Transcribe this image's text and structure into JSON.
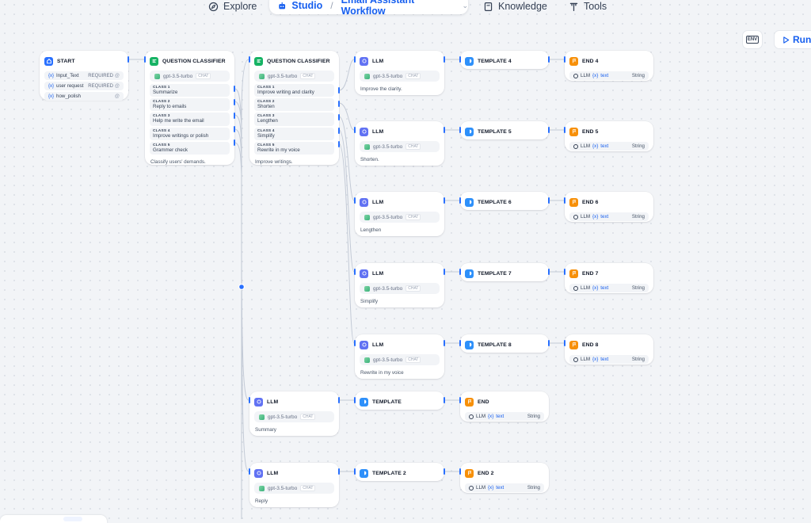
{
  "nav": {
    "explore": "Explore",
    "studio": "Studio",
    "separator": "/",
    "app_name": "Email Assistant Workflow",
    "knowledge": "Knowledge",
    "tools": "Tools"
  },
  "toolbar": {
    "env_label": "ENV",
    "run_label": "Run"
  },
  "start": {
    "title": "START",
    "vars": [
      {
        "name": "Input_Text",
        "flag": "REQUIRED"
      },
      {
        "name": "user request",
        "flag": "REQUIRED"
      },
      {
        "name": "how_polish",
        "flag": ""
      }
    ]
  },
  "qc1": {
    "title": "QUESTION CLASSIFIER",
    "model": "gpt-3.5-turbo",
    "mode": "CHAT",
    "classes": [
      {
        "label": "CLASS 1",
        "value": "Summarize"
      },
      {
        "label": "CLASS 2",
        "value": "Reply to emails"
      },
      {
        "label": "CLASS 3",
        "value": "Help me write the email"
      },
      {
        "label": "CLASS 4",
        "value": "Improve writings or polish"
      },
      {
        "label": "CLASS 5",
        "value": "Grammer check"
      }
    ],
    "desc": "Classify users' demands."
  },
  "qc2": {
    "title": "QUESTION CLASSIFIER",
    "model": "gpt-3.5-turbo",
    "mode": "CHAT",
    "classes": [
      {
        "label": "CLASS 1",
        "value": "Improve writing and clarity"
      },
      {
        "label": "CLASS 2",
        "value": "Shorten"
      },
      {
        "label": "CLASS 3",
        "value": "Lengthen"
      },
      {
        "label": "CLASS 4",
        "value": "Simplify"
      },
      {
        "label": "CLASS 5",
        "value": "Rewrite in my voice"
      }
    ],
    "desc": "Improve writings."
  },
  "llm_nodes": [
    {
      "title": "LLM",
      "model": "gpt-3.5-turbo",
      "mode": "CHAT",
      "desc": "Improve the clarity."
    },
    {
      "title": "LLM",
      "model": "gpt-3.5-turbo",
      "mode": "CHAT",
      "desc": "Shorten."
    },
    {
      "title": "LLM",
      "model": "gpt-3.5-turbo",
      "mode": "CHAT",
      "desc": "Lengthen"
    },
    {
      "title": "LLM",
      "model": "gpt-3.5-turbo",
      "mode": "CHAT",
      "desc": "Simplify"
    },
    {
      "title": "LLM",
      "model": "gpt-3.5-turbo",
      "mode": "CHAT",
      "desc": "Rewrite in my voice"
    },
    {
      "title": "LLM",
      "model": "gpt-3.5-turbo",
      "mode": "CHAT",
      "desc": "Summary"
    },
    {
      "title": "LLM",
      "model": "gpt-3.5-turbo",
      "mode": "CHAT",
      "desc": "Reply"
    }
  ],
  "template_nodes": [
    {
      "title": "TEMPLATE 4"
    },
    {
      "title": "TEMPLATE 5"
    },
    {
      "title": "TEMPLATE 6"
    },
    {
      "title": "TEMPLATE 7"
    },
    {
      "title": "TEMPLATE 8"
    },
    {
      "title": "TEMPLATE"
    },
    {
      "title": "TEMPLATE 2"
    }
  ],
  "end_nodes": [
    {
      "title": "END 4",
      "src": "LLM",
      "var": "text",
      "type": "String"
    },
    {
      "title": "END 5",
      "src": "LLM",
      "var": "text",
      "type": "String"
    },
    {
      "title": "END 6",
      "src": "LLM",
      "var": "text",
      "type": "String"
    },
    {
      "title": "END 7",
      "src": "LLM",
      "var": "text",
      "type": "String"
    },
    {
      "title": "END 8",
      "src": "LLM",
      "var": "text",
      "type": "String"
    },
    {
      "title": "END",
      "src": "LLM",
      "var": "text",
      "type": "String"
    },
    {
      "title": "END 2",
      "src": "LLM",
      "var": "text",
      "type": "String"
    }
  ],
  "colors": {
    "accent": "#155eef",
    "start_icon": "#2970ff",
    "classifier_icon": "#16b364",
    "llm_icon": "#6172f3",
    "template_icon": "#2e90fa",
    "end_icon": "#f79009",
    "edge": "#c3cad6"
  }
}
